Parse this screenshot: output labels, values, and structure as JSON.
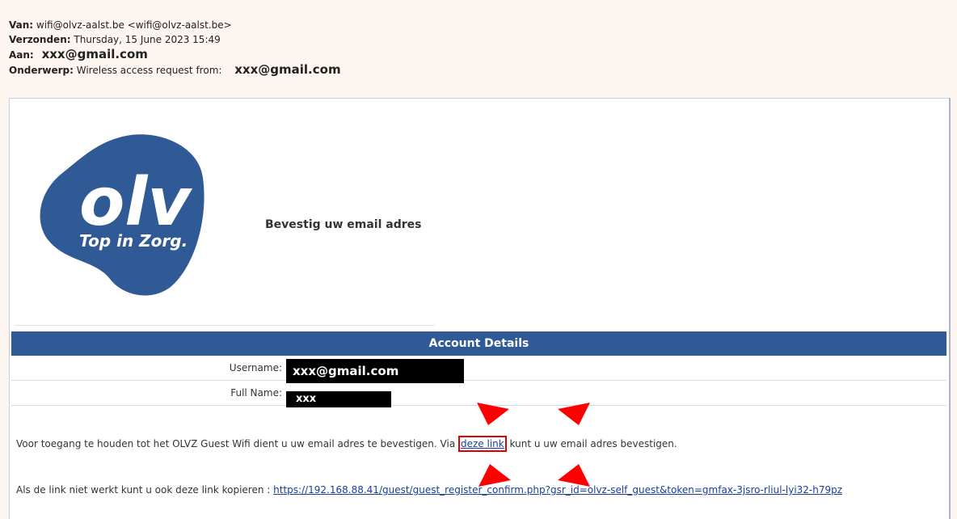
{
  "email": {
    "from_label": "Van:",
    "from_value": "wifi@olvz-aalst.be <wifi@olvz-aalst.be>",
    "sent_label": "Verzonden:",
    "sent_value": "Thursday, 15 June 2023 15:49",
    "to_label": "Aan:",
    "to_value": "xxx@gmail.com",
    "subject_label": "Onderwerp:",
    "subject_value": "Wireless access request from:",
    "subject_email": "xxx@gmail.com"
  },
  "logo": {
    "main_text": "olv",
    "tagline": "Top in Zorg.",
    "color": "#2f5a96"
  },
  "confirm_title": "Bevestig uw email adres",
  "account": {
    "header": "Account Details",
    "username_label": "Username:",
    "username_value": "xxx@gmail.com",
    "fullname_label": "Full Name:",
    "fullname_value": "xxx"
  },
  "message": {
    "line1_before": "Voor toegang te houden tot het OLVZ Guest Wifi dient u uw email adres te bevestigen. Via ",
    "line1_link": "deze link",
    "line1_after": " kunt u uw email adres bevestigen.",
    "line2_before": "Als de link niet werkt kunt u ook deze link kopieren : ",
    "line2_link": "https://192.168.88.41/guest/guest_register_confirm.php?gsr_id=olvz-self_guest&token=gmfax-3jsro-rliul-lyi32-h79pz"
  },
  "colors": {
    "accent": "#2f5a96",
    "highlight": "#e00000"
  }
}
